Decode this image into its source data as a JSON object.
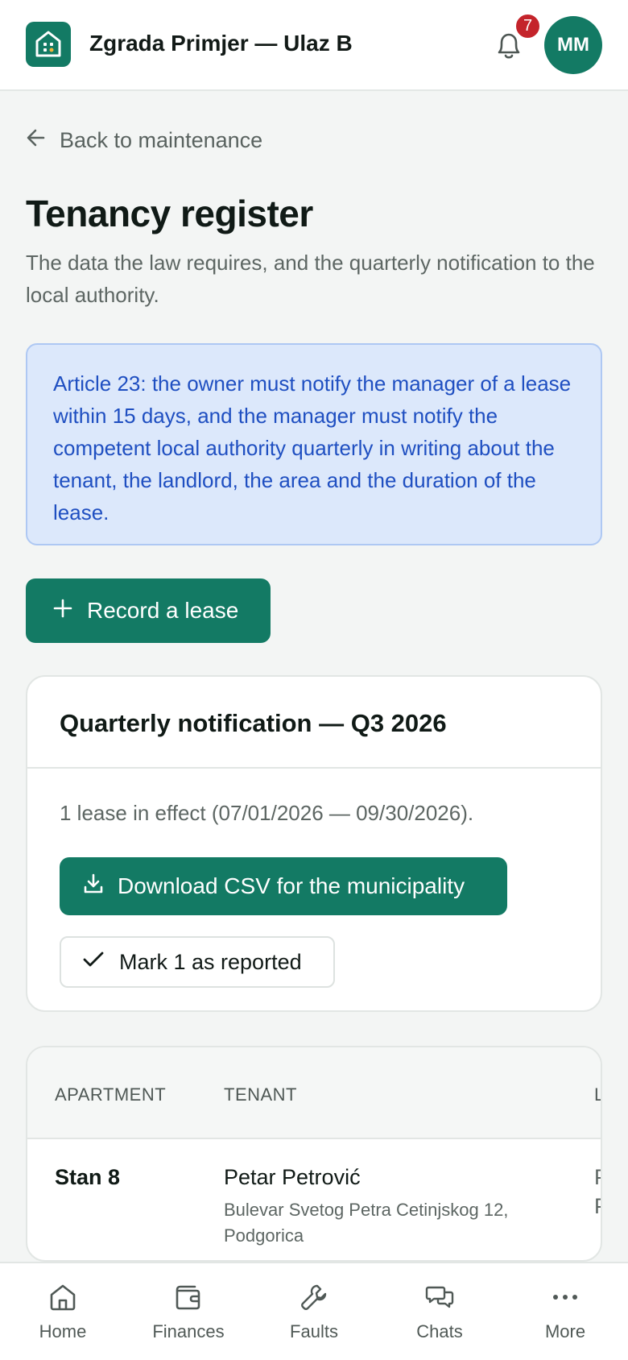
{
  "header": {
    "app_title": "Zgrada Primjer — Ulaz B",
    "notification_count": "7",
    "avatar_initials": "MM"
  },
  "back_link": "Back to maintenance",
  "page": {
    "title": "Tenancy register",
    "subtitle": "The data the law requires, and the quarterly notification to the local authority."
  },
  "notice": "Article 23: the owner must notify the manager of a lease within 15 days, and the manager must notify the competent local authority quarterly in writing about the tenant, the landlord, the area and the duration of the lease.",
  "record_button": "Record a lease",
  "quarterly_card": {
    "title": "Quarterly notification — Q3 2026",
    "summary": "1 lease in effect (07/01/2026 — 09/30/2026).",
    "download_button": "Download CSV for the municipality",
    "mark_button": "Mark 1 as reported"
  },
  "table": {
    "headers": [
      "APARTMENT",
      "TENANT",
      "L"
    ],
    "rows": [
      {
        "apartment": "Stan 8",
        "tenant": "Petar Petrović",
        "address": "Bulevar Svetog Petra Cetinjskog 12, Podgorica",
        "clipped_1": "P",
        "clipped_2": "P"
      }
    ]
  },
  "bottom_nav": [
    {
      "label": "Home",
      "icon": "home-icon"
    },
    {
      "label": "Finances",
      "icon": "wallet-icon"
    },
    {
      "label": "Faults",
      "icon": "wrench-icon"
    },
    {
      "label": "Chats",
      "icon": "chat-icon"
    },
    {
      "label": "More",
      "icon": "more-icon"
    }
  ],
  "colors": {
    "brand": "#137a64",
    "notice_bg": "#dce8fb",
    "notice_text": "#1f4fc1",
    "badge": "#c4242b"
  }
}
